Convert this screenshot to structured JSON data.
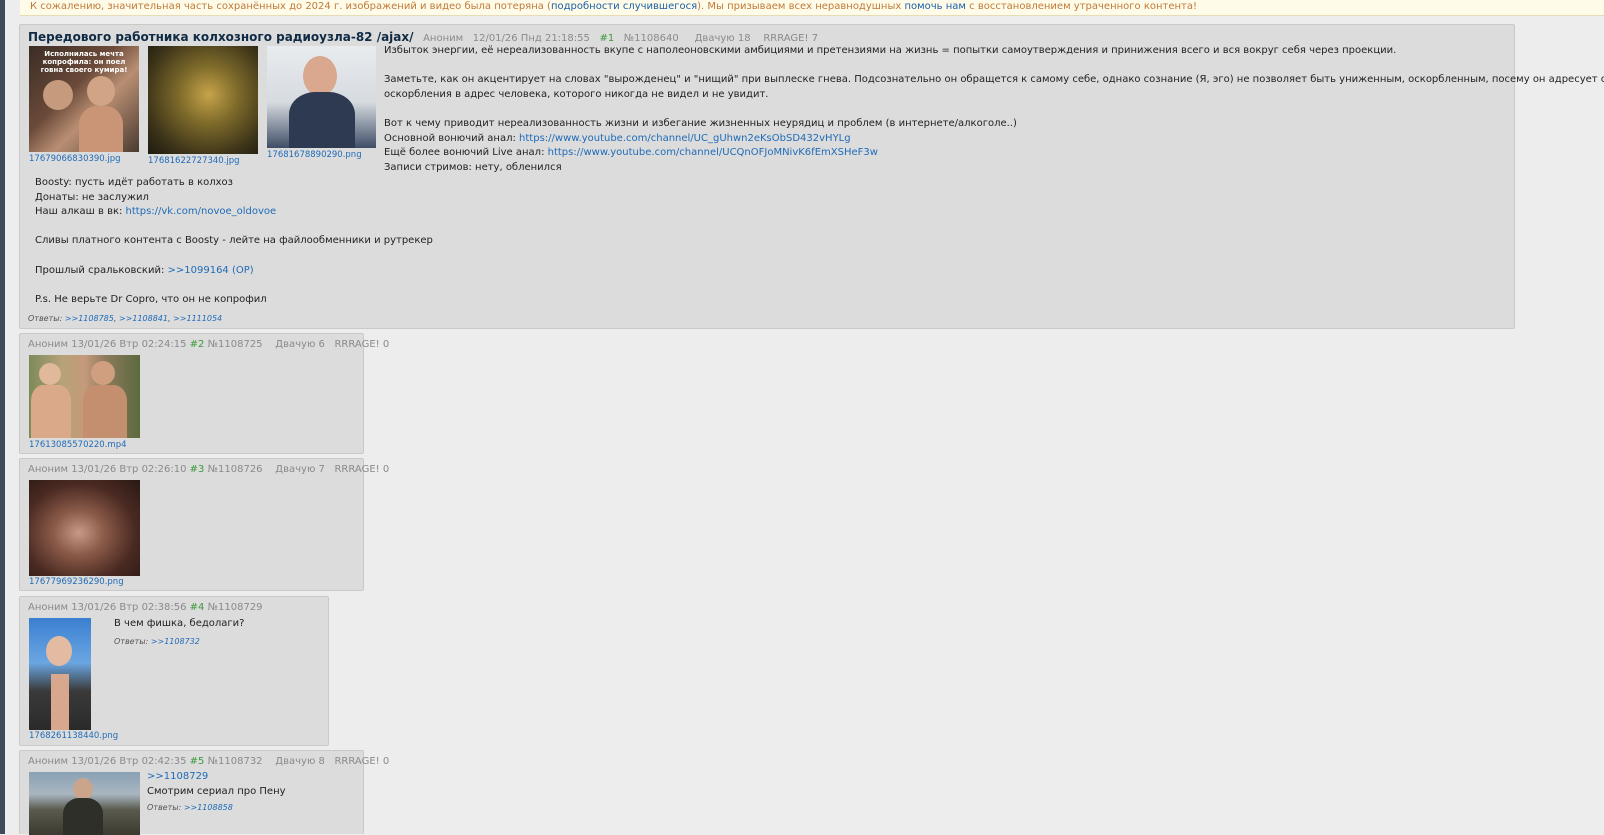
{
  "notice": {
    "part1": "К сожалению, значительная часть сохранённых до 2024 г. изображений и видео была потеряна (",
    "link1": "подробности случившегося",
    "part2": "). Мы призываем всех неравнодушных ",
    "link2": "помочь нам",
    "part3": " с восстановлением утраченного контента!"
  },
  "op": {
    "title": "Передового работника колхозного радиоузла-82 /ajax/",
    "author": "Аноним",
    "date": "12/01/26 Пнд 21:18:55",
    "index": "#1",
    "id": "№1108640",
    "dvachuyu": "Двачую 18",
    "rrrage": "RRRAGE! 7",
    "images": [
      {
        "file": "17679066830390.jpg",
        "caption": "Исполнилась мечта копрофила: он поел говна своего кумира!"
      },
      {
        "file": "17681622727340.jpg",
        "caption": ""
      },
      {
        "file": "17681678890290.png",
        "caption": ""
      }
    ],
    "right_text": {
      "l1": "Избыток энергии, её нереализованность вкупе с наполеоновскими амбициями и претензиями на жизнь = попытки самоутверждения и принижения всего и вся вокруг себя через проекции.",
      "l2": "Заметьте, как он акцентирует на словах \"вырожденец\" и \"нищий\" при выплеске гнева. Подсознательно он обращется к самому себе, однако сознание (Я, эго) не позволяет быть униженным, оскорбленным, посему он адресует свои",
      "l3": "оскорбления в адрес человека, которого никогда не видел и не увидит.",
      "l4": "Вот к чему приводит нереализованность жизни и избегание жизненных неурядиц и проблем (в интернете/алкоголе..)",
      "l5_prefix": "Основной вонючий анал: ",
      "l5_link": "https://www.youtube.com/channel/UC_gUhwn2eKsObSD432vHYLg",
      "l6_prefix": "Ещё более вонючий Live анал: ",
      "l6_link": "https://www.youtube.com/channel/UCQnOFJoMNivK6fEmXSHeF3w",
      "l7": "Записи стримов: нету, обленился"
    },
    "left_text": {
      "l1": "Boosty: пусть идёт работать в колхоз",
      "l2": "Донаты: не заслужил",
      "l3_prefix": "Наш алкаш в вк: ",
      "l3_link": "https://vk.com/novoe_oldovoe",
      "l4": "Сливы платного контента с Boosty - лейте на файлообменники и рутрекер",
      "l5_prefix": "Прошлый сральковский: ",
      "l5_link": ">>1099164 (OP)",
      "l6": "P.s. Не верьте Dr Copro, что он не копрофил"
    },
    "replies_label": "Ответы:",
    "replies": [
      ">>1108785",
      ">>1108841",
      ">>1111054"
    ]
  },
  "posts": [
    {
      "author": "Аноним",
      "date": "13/01/26 Втр 02:24:15",
      "index": "#2",
      "id": "№1108725",
      "dvachuyu": "Двачую 6",
      "rrrage": "RRRAGE! 0",
      "file": "17613085570220.mp4"
    },
    {
      "author": "Аноним",
      "date": "13/01/26 Втр 02:26:10",
      "index": "#3",
      "id": "№1108726",
      "dvachuyu": "Двачую 7",
      "rrrage": "RRRAGE! 0",
      "file": "17677969236290.png"
    },
    {
      "author": "Аноним",
      "date": "13/01/26 Втр 02:38:56",
      "index": "#4",
      "id": "№1108729",
      "file": "1768261138440.png",
      "text": "В чем фишка, бедолаги?",
      "replies_label": "Ответы:",
      "reply": ">>1108732"
    },
    {
      "author": "Аноним",
      "date": "13/01/26 Втр 02:42:35",
      "index": "#5",
      "id": "№1108732",
      "dvachuyu": "Двачую 8",
      "rrrage": "RRRAGE! 0",
      "quote": ">>1108729",
      "text": "Смотрим сериал про Пену",
      "replies_label": "Ответы:",
      "reply": ">>1108858"
    }
  ],
  "colors": {
    "background": "#ededed",
    "post_bg": "#dcdcdc",
    "link": "#1f6bb8",
    "post_number": "#3b9a3b",
    "notice_text": "#c07a38"
  }
}
